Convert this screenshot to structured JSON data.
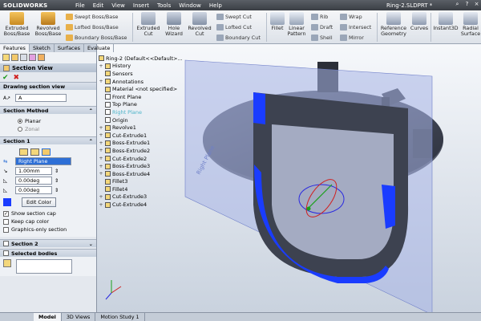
{
  "app": {
    "logo": "SOLIDWORKS",
    "doc_title": "Ring-2.SLDPRT *"
  },
  "menu": [
    "File",
    "Edit",
    "View",
    "Insert",
    "Tools",
    "Window",
    "Help"
  ],
  "ribbon": {
    "extruded_boss": "Extruded\nBoss/Base",
    "revolved_boss": "Revolved\nBoss/Base",
    "swept_boss": "Swept Boss/Base",
    "lofted_boss": "Lofted Boss/Base",
    "boundary_boss": "Boundary Boss/Base",
    "extruded_cut": "Extruded\nCut",
    "hole_wizard": "Hole\nWizard",
    "revolved_cut": "Revolved\nCut",
    "swept_cut": "Swept Cut",
    "lofted_cut": "Lofted Cut",
    "boundary_cut": "Boundary Cut",
    "fillet": "Fillet",
    "linear_pattern": "Linear\nPattern",
    "rib": "Rib",
    "draft": "Draft",
    "shell": "Shell",
    "wrap": "Wrap",
    "intersect": "Intersect",
    "mirror": "Mirror",
    "ref_geometry": "Reference\nGeometry",
    "curves": "Curves",
    "instant3d": "Instant3D",
    "radial_surface": "Radial\nSurface"
  },
  "panel": {
    "tabs": [
      "Features",
      "Sketch",
      "Surfaces",
      "Evaluate"
    ],
    "title": "Section View",
    "drawing_section_header": "Drawing section view",
    "drawing_section_value": "A",
    "section_method_header": "Section Method",
    "planar_label": "Planar",
    "zonal_label": "Zonal",
    "section1_header": "Section 1",
    "plane_value": "Right Plane",
    "offset_value": "1.00mm",
    "angle1_value": "0.00deg",
    "angle2_value": "0.00deg",
    "edit_color_label": "Edit Color",
    "show_section_cap": "Show section cap",
    "keep_cap_color": "Keep cap color",
    "graphics_only": "Graphics-only section",
    "section2_header": "Section 2",
    "selected_bodies_header": "Selected bodies",
    "cap_color": "#1a3cff"
  },
  "tree": {
    "root": "Ring-2  (Default<<Default>...",
    "items": [
      {
        "label": "History",
        "exp": "+"
      },
      {
        "label": "Sensors",
        "exp": ""
      },
      {
        "label": "Annotations",
        "exp": "+"
      },
      {
        "label": "Material <not specified>",
        "exp": ""
      },
      {
        "label": "Front Plane",
        "exp": ""
      },
      {
        "label": "Top Plane",
        "exp": ""
      },
      {
        "label": "Right Plane",
        "exp": "",
        "dim": true
      },
      {
        "label": "Origin",
        "exp": ""
      },
      {
        "label": "Revolve1",
        "exp": "+"
      },
      {
        "label": "Cut-Extrude1",
        "exp": "+"
      },
      {
        "label": "Boss-Extrude1",
        "exp": "+"
      },
      {
        "label": "Boss-Extrude2",
        "exp": "+"
      },
      {
        "label": "Cut-Extrude2",
        "exp": "+"
      },
      {
        "label": "Boss-Extrude3",
        "exp": "+"
      },
      {
        "label": "Boss-Extrude4",
        "exp": "+"
      },
      {
        "label": "Fillet3",
        "exp": ""
      },
      {
        "label": "Fillet4",
        "exp": ""
      },
      {
        "label": "Cut-Extrude3",
        "exp": "+"
      },
      {
        "label": "Cut-Extrude4",
        "exp": "+"
      }
    ]
  },
  "viewport": {
    "plane_label": "Right Plane"
  },
  "bottom_tabs": [
    "Model",
    "3D Views",
    "Motion Study 1"
  ],
  "colors": {
    "accent": "#2d6fd6",
    "model_dark": "#3d4250",
    "section_blue": "#1a3cff",
    "plane": "#a8b4e6"
  }
}
